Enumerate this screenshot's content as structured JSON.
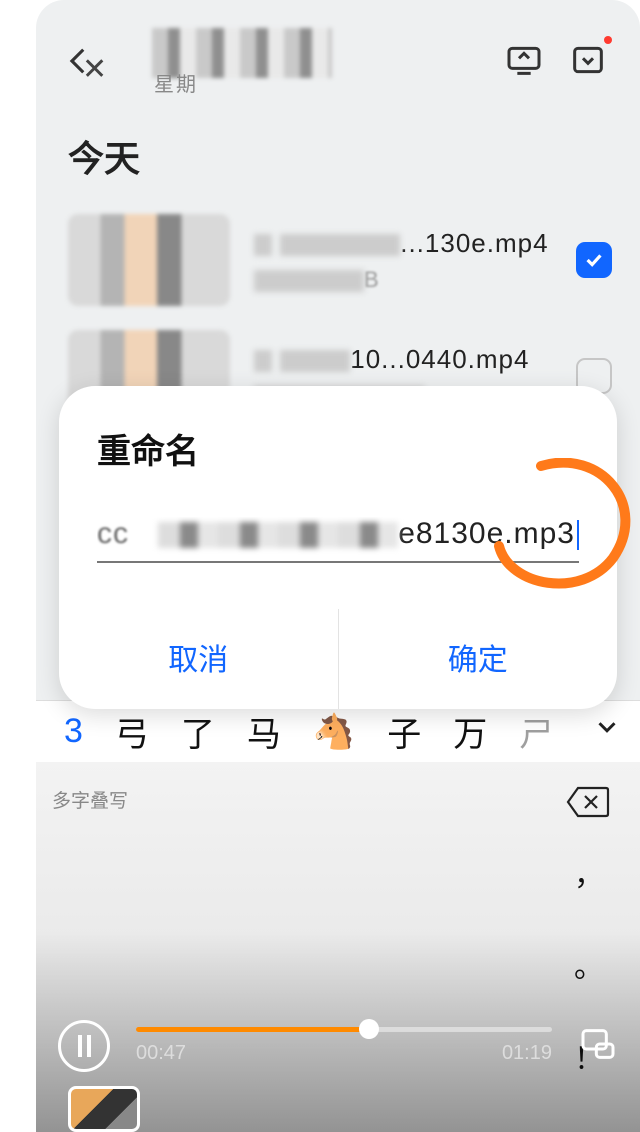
{
  "header": {
    "weekday_label": "星期"
  },
  "section": {
    "today": "今天"
  },
  "files": [
    {
      "name_suffix": "...130e.mp4",
      "sub_suffix": "B",
      "checked": true
    },
    {
      "name_suffix": "10...0440.mp4",
      "sub_suffix": "",
      "checked": false
    }
  ],
  "dialog": {
    "title": "重命名",
    "input_prefix": "cc",
    "input_suffix": "e8130e.mp3",
    "cancel": "取消",
    "confirm": "确定"
  },
  "ime": {
    "candidates": [
      "3",
      "弓",
      "了",
      "马",
      "🐴",
      "子",
      "万",
      "ㄕ"
    ],
    "hint": "多字叠写",
    "side_keys": [
      "，",
      "。",
      "！"
    ]
  },
  "video": {
    "current": "00:47",
    "total": "01:19",
    "progress_pct": 56
  }
}
